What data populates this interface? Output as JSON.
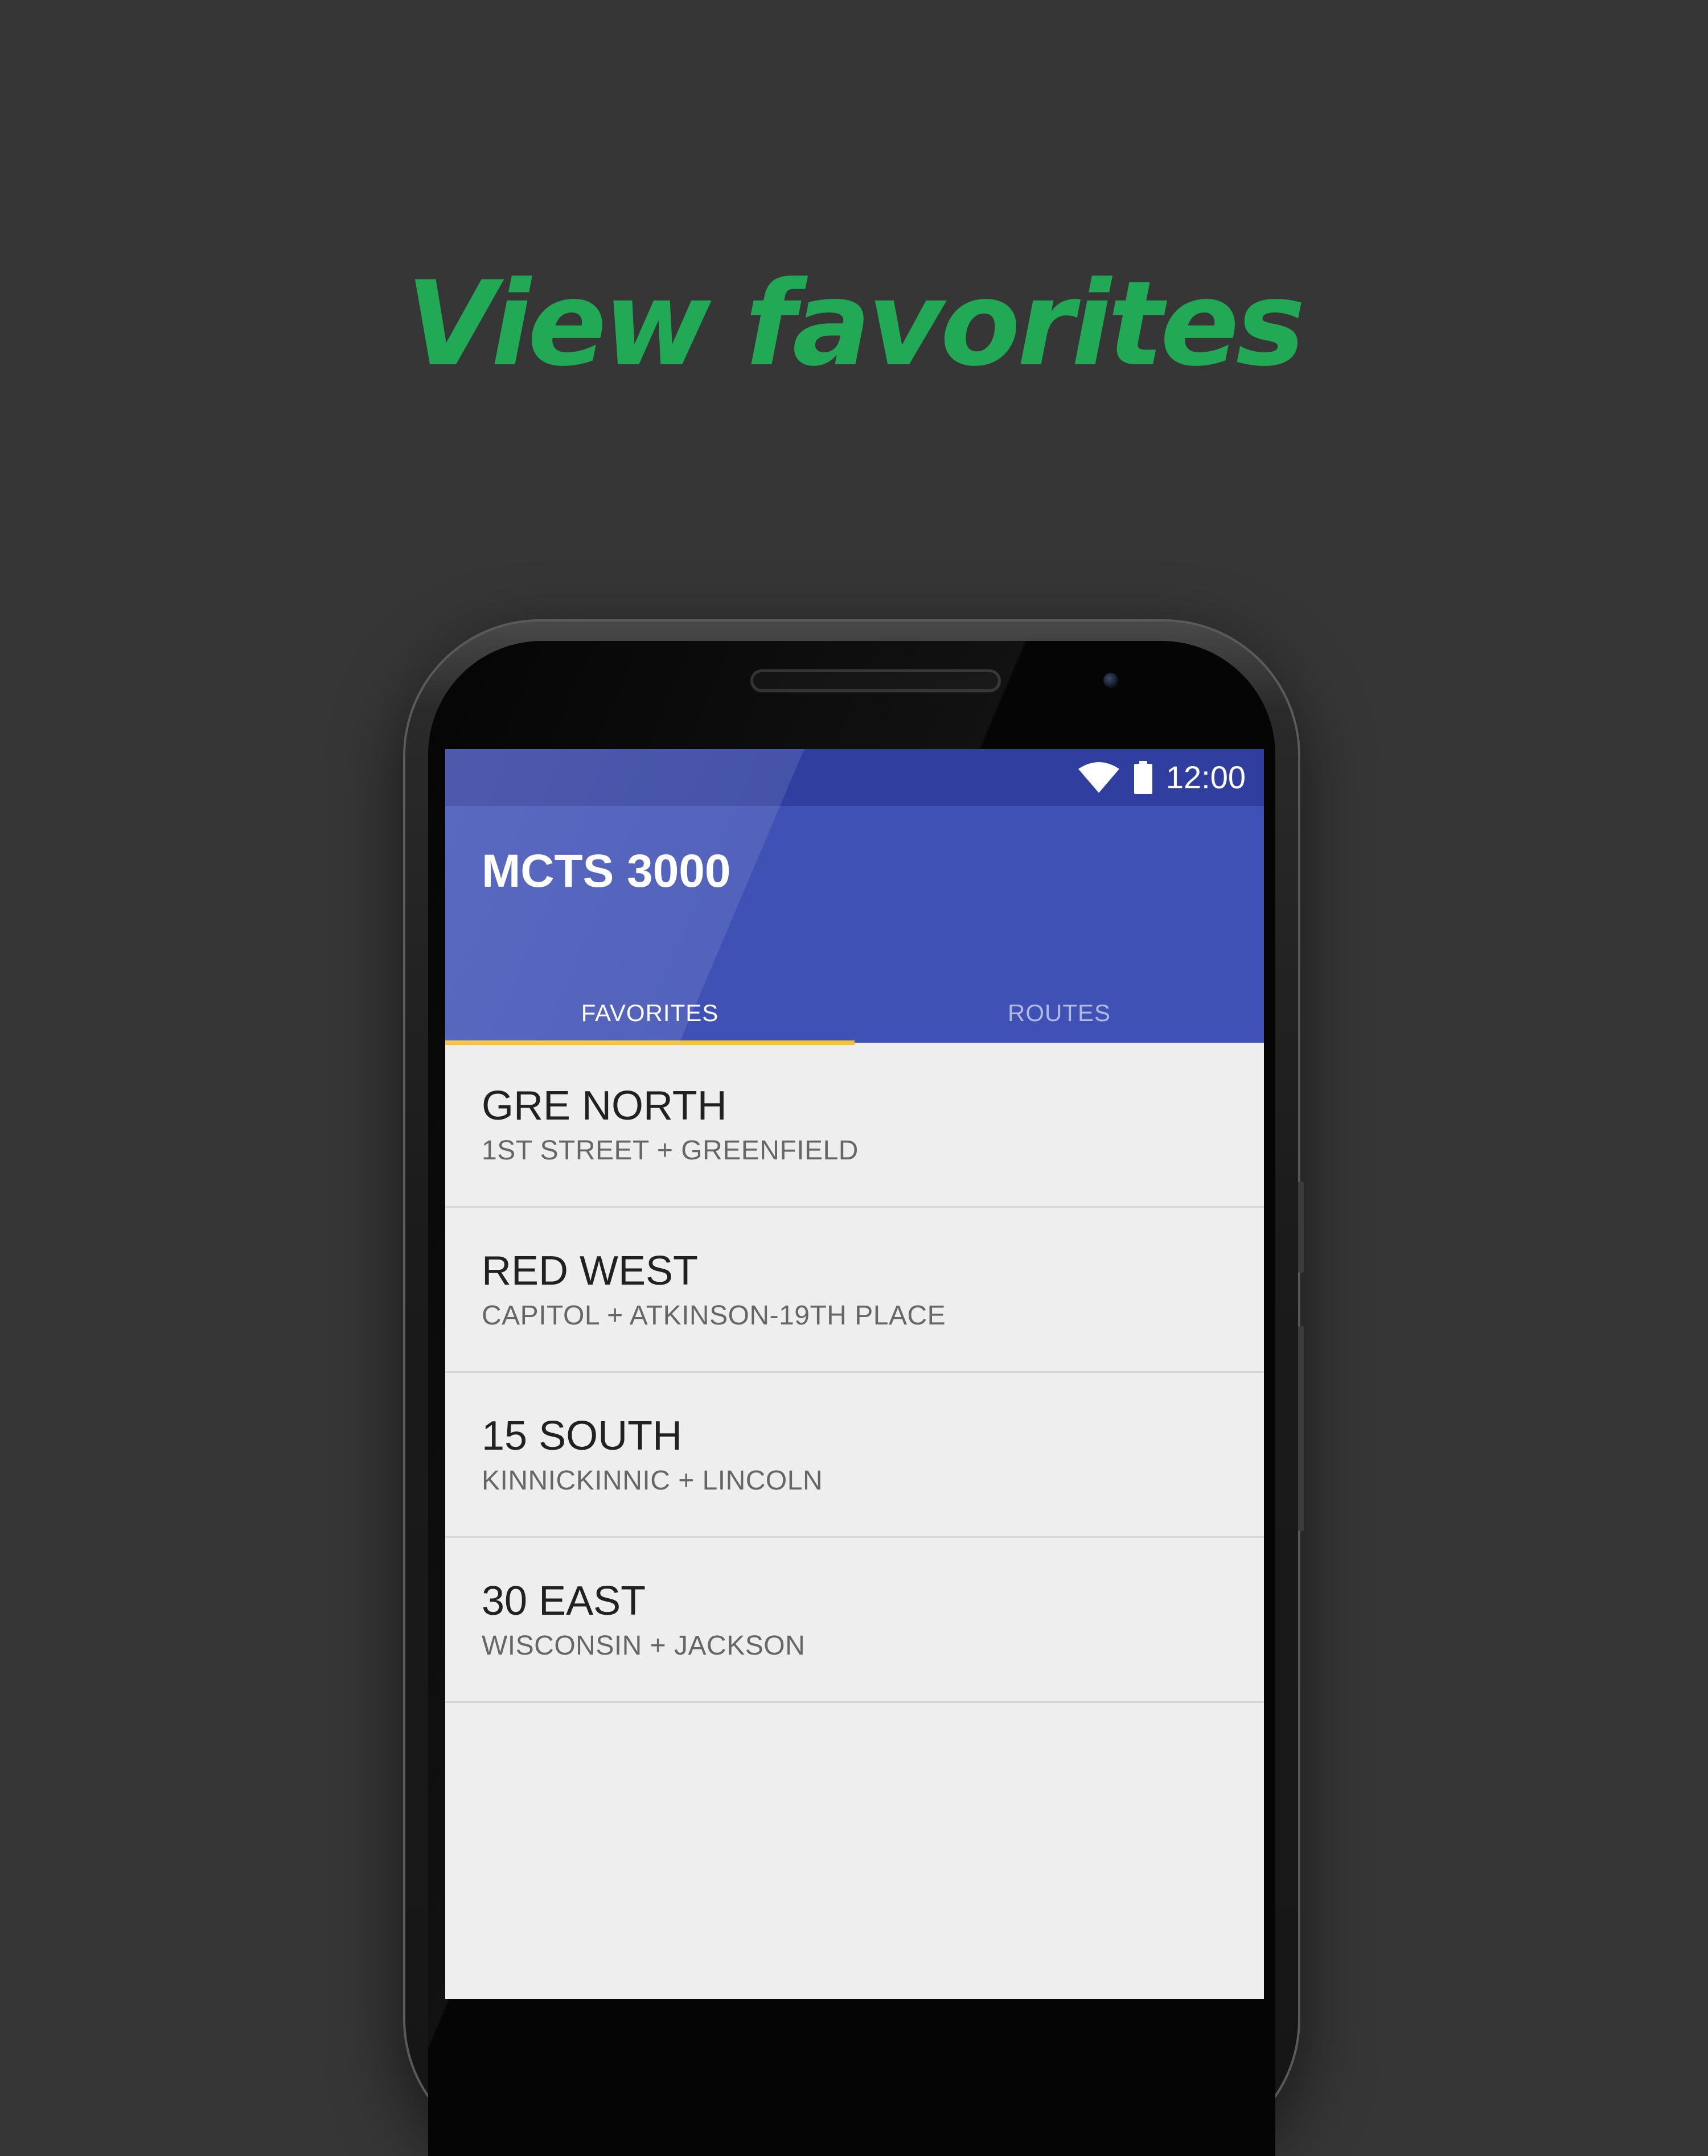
{
  "headline": "View favorites",
  "status_bar": {
    "time": "12:00",
    "icons": [
      "wifi-icon",
      "battery-icon"
    ]
  },
  "app": {
    "title": "MCTS 3000"
  },
  "tabs": [
    {
      "label": "FAVORITES",
      "active": true
    },
    {
      "label": "ROUTES",
      "active": false
    }
  ],
  "favorites": [
    {
      "title": "GRE NORTH",
      "subtitle": "1ST STREET + GREENFIELD"
    },
    {
      "title": "RED WEST",
      "subtitle": "CAPITOL + ATKINSON-19TH PLACE"
    },
    {
      "title": "15 SOUTH",
      "subtitle": "KINNICKINNIC + LINCOLN"
    },
    {
      "title": "30 EAST",
      "subtitle": "WISCONSIN + JACKSON"
    }
  ],
  "colors": {
    "background": "#363636",
    "headline": "#21a955",
    "primary": "#3f51b5",
    "primary_dark": "#303f9f",
    "tab_indicator": "#f5c234",
    "list_background": "#eeeeee"
  }
}
